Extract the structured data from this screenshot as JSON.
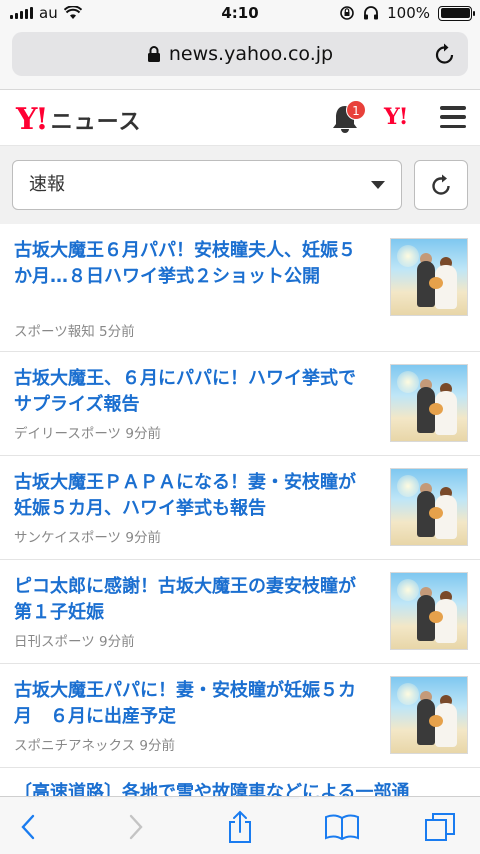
{
  "status_bar": {
    "carrier": "au",
    "time": "4:10",
    "battery": "100%"
  },
  "url_bar": {
    "url": "news.yahoo.co.jp"
  },
  "header": {
    "logo_mark": "Y!",
    "logo_text": "ニュース",
    "notification_count": "1",
    "yahoo_mark": "Y!"
  },
  "filter": {
    "selected": "速報"
  },
  "articles": [
    {
      "title": "古坂大魔王６月パパ！安枝瞳夫人、妊娠５か月…８日ハワイ挙式２ショット公開",
      "source": "スポーツ報知",
      "time": "5分前"
    },
    {
      "title": "古坂大魔王、６月にパパに！ハワイ挙式でサプライズ報告",
      "source": "デイリースポーツ",
      "time": "9分前"
    },
    {
      "title": "古坂大魔王ＰＡＰＡになる！妻・安枝瞳が妊娠５カ月、ハワイ挙式も報告",
      "source": "サンケイスポーツ",
      "time": "9分前"
    },
    {
      "title": "ピコ太郎に感謝！古坂大魔王の妻安枝瞳が第１子妊娠",
      "source": "日刊スポーツ",
      "time": "9分前"
    },
    {
      "title": "古坂大魔王パパに！妻・安枝瞳が妊娠５カ月　６月に出産予定",
      "source": "スポニチアネックス",
      "time": "9分前"
    }
  ],
  "partial_article": {
    "title": "〔高速道路〕各地で雪や故障車などによる一部通"
  },
  "icons": {
    "lock": "lock-icon",
    "reload": "reload-icon",
    "bell": "bell-icon",
    "menu": "hamburger-icon",
    "refresh": "refresh-icon",
    "back": "chevron-left-icon",
    "forward": "chevron-right-icon",
    "share": "share-icon",
    "bookmarks": "book-icon",
    "tabs": "tabs-icon"
  },
  "colors": {
    "link": "#1b6fd0",
    "brand": "#ff0033",
    "badge": "#e8403a",
    "toolbar_icon": "#1a7cf0"
  }
}
